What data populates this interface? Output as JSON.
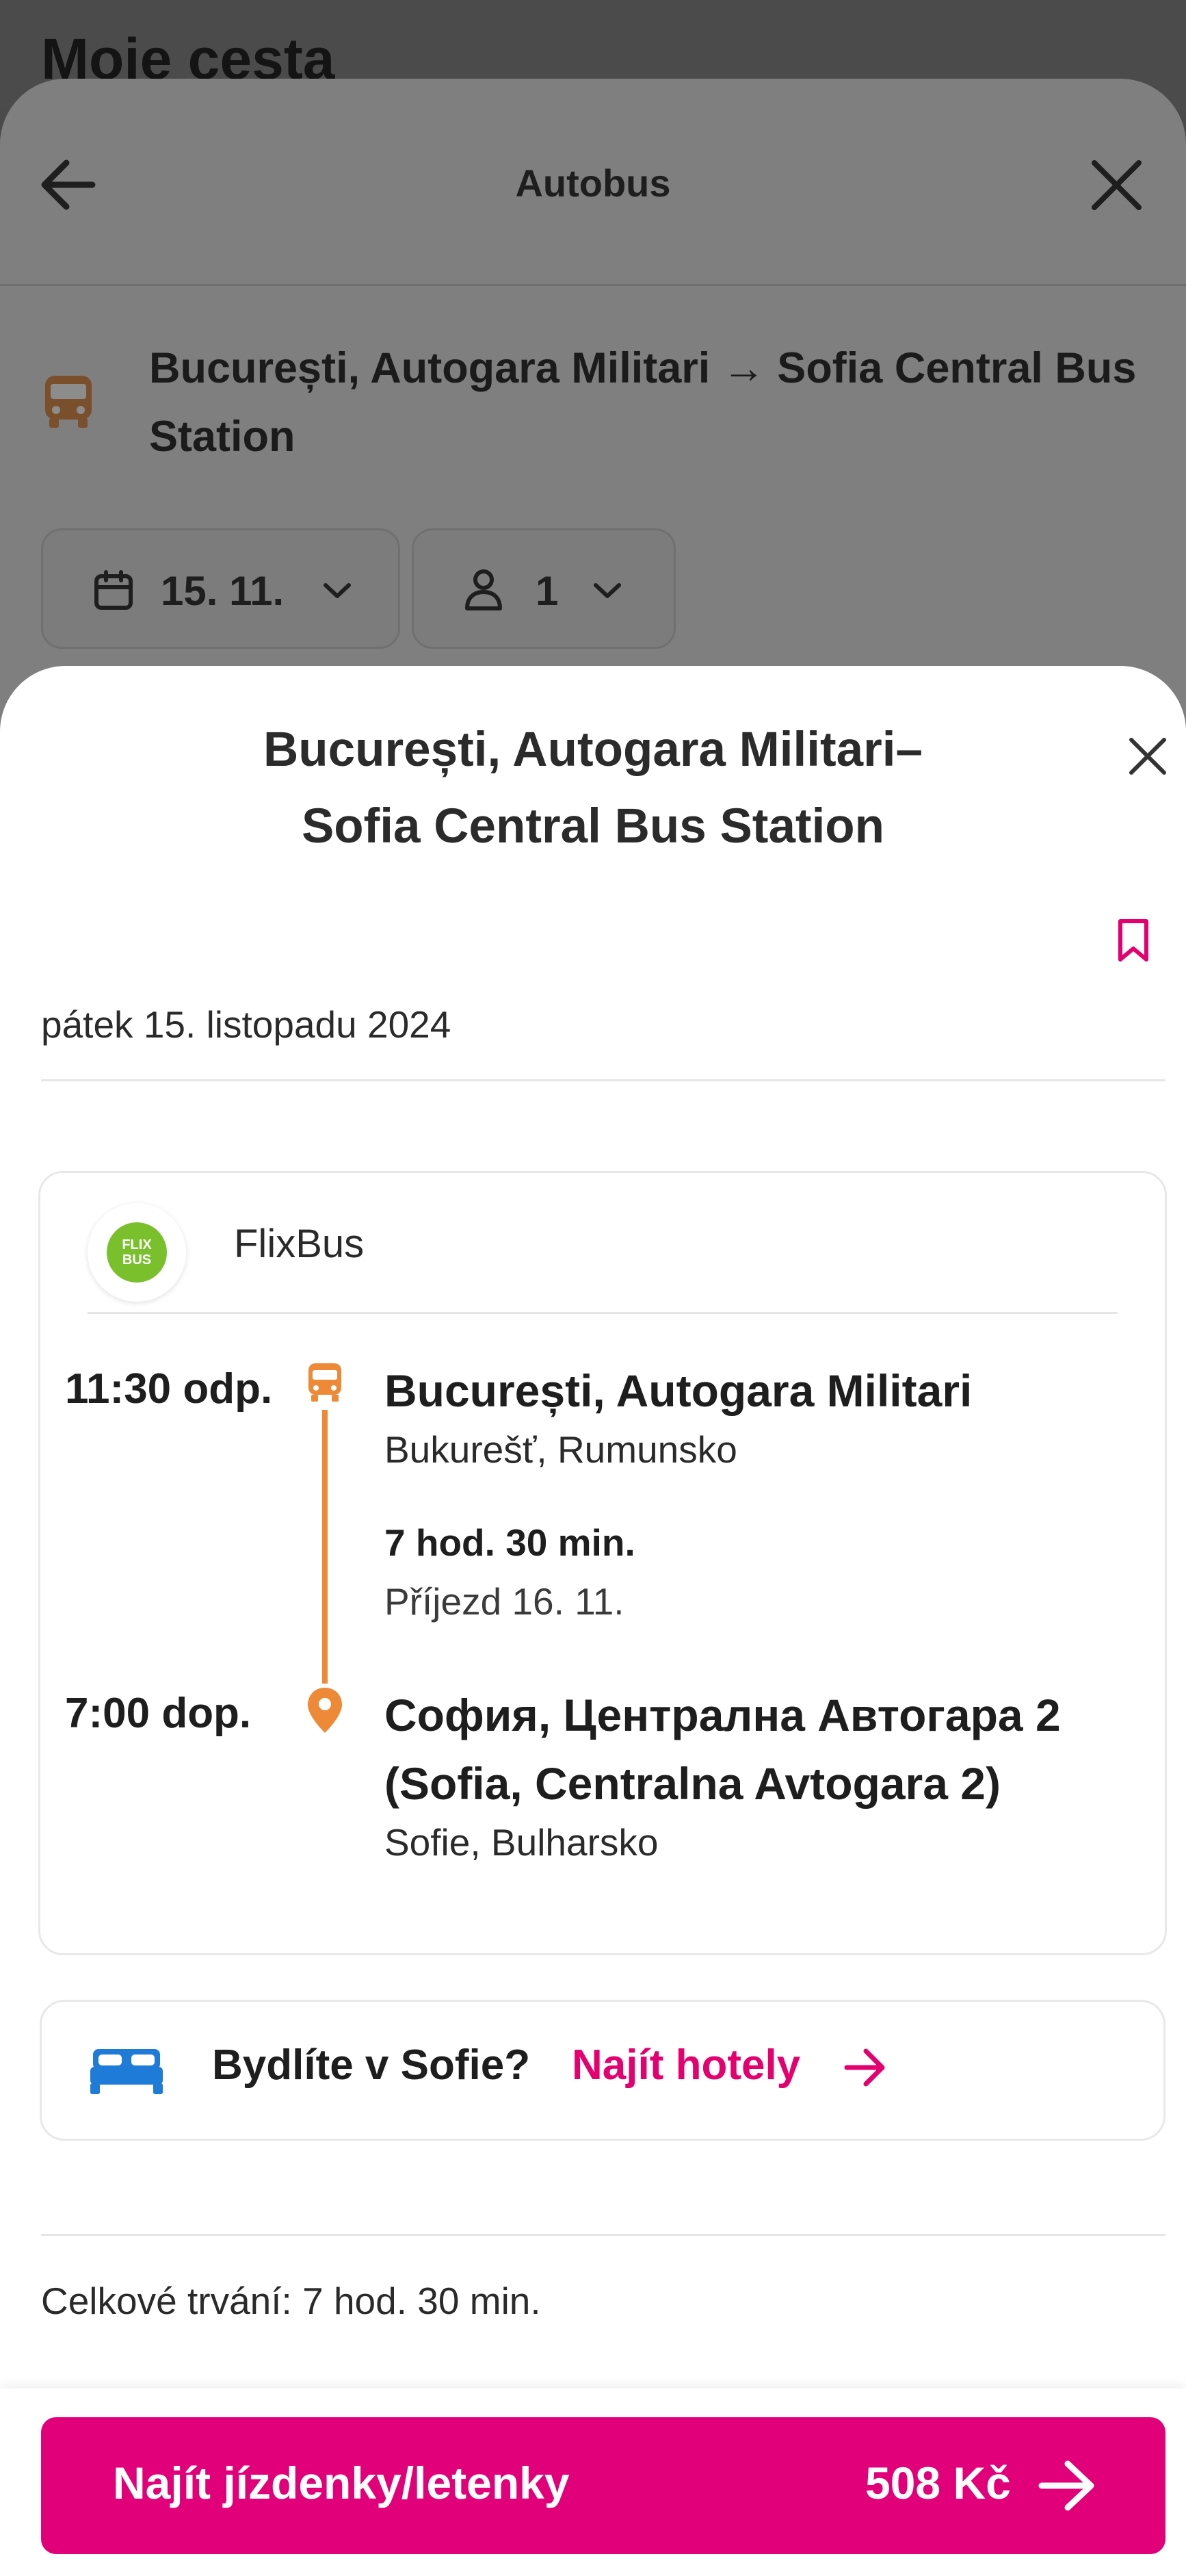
{
  "background": {
    "page_title": "Moje cesta",
    "topbar_title": "Autobus",
    "route": "București, Autogara Militari → Sofia Central Bus Station",
    "date_chip": "15. 11.",
    "passengers_chip": "1"
  },
  "modal": {
    "title_line1": "București, Autogara Militari–",
    "title_line2": "Sofia Central Bus Station",
    "date": "pátek 15. listopadu 2024",
    "carrier": "FlixBus",
    "carrier_logo_text": "FLIX BUS",
    "departure": {
      "time": "11:30 odp.",
      "station": "București, Autogara Militari",
      "city": "Bukurešť, Rumunsko"
    },
    "duration": "7 hod. 30 min.",
    "arrival_note": "Příjezd 16. 11.",
    "arrival": {
      "time": "7:00 dop.",
      "station_line1": "София, Централна Автогара 2",
      "station_line2": "(Sofia, Centralna Avtogara 2)",
      "city": "Sofie, Bulharsko"
    },
    "hotel_question": "Bydlíte v Sofie?",
    "hotel_link": "Najít hotely",
    "total_duration": "Celkové trvání: 7 hod. 30 min.",
    "cta_label": "Najít jízdenky/letenky",
    "cta_price": "508 Kč"
  },
  "colors": {
    "accent": "#e2007a",
    "transit_orange": "#ee8a37",
    "flixbus_green": "#7ac02c",
    "bed_blue": "#1f7bd8"
  }
}
